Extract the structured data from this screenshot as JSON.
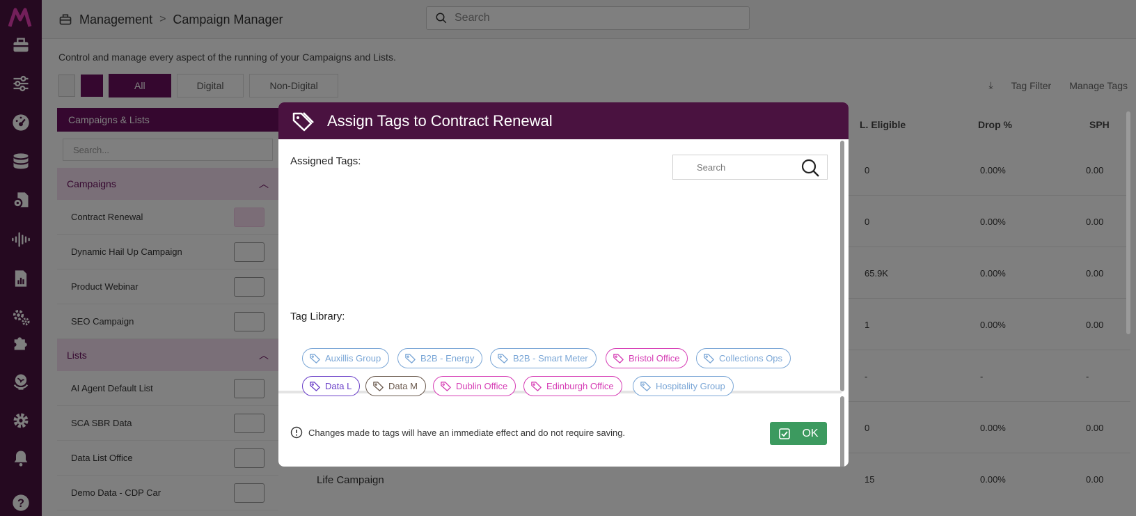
{
  "app": {
    "logo_text": "M"
  },
  "breadcrumb": {
    "section": "Management",
    "separator": ">",
    "page": "Campaign Manager"
  },
  "top_search": {
    "placeholder": "Search"
  },
  "page": {
    "description": "Control and manage every aspect of the running of your Campaigns and Lists.",
    "filters": [
      "All",
      "Digital",
      "Non-Digital"
    ],
    "tools": [
      "Tag Filter",
      "Manage Tags"
    ],
    "list_header": "Campaigns & Lists",
    "list_search_placeholder": "Search...",
    "groups": {
      "campaigns": "Campaigns",
      "lists": "Lists"
    },
    "campaign_rows": [
      "Contract Renewal",
      "Dynamic Hail Up Campaign",
      "Product Webinar",
      "SEO Campaign"
    ],
    "list_rows": [
      "AI Agent Default List",
      "SCA SBR Data",
      "Data List Office",
      "Demo Data - CDP Car"
    ],
    "table_headers": [
      "L. Eligible",
      "Drop %",
      "SPH"
    ],
    "table_rows": [
      [
        "0",
        "0.00%",
        "0.00"
      ],
      [
        "0",
        "0.00%",
        "0.00"
      ],
      [
        "65.9K",
        "0.00%",
        "0.00"
      ],
      [
        "1",
        "0.00%",
        "0.00"
      ],
      [
        "-",
        "-",
        "-"
      ],
      [
        "0",
        "0.00%",
        "0.00"
      ],
      [
        "15",
        "0.00%",
        "0.00"
      ]
    ],
    "extra_row_label": "Life Campaign"
  },
  "modal": {
    "title": "Assign Tags to Contract Renewal",
    "assigned_label": "Assigned Tags:",
    "search_placeholder": "Search",
    "library_label": "Tag Library:",
    "tags": [
      {
        "label": "Auxillis Group",
        "color": "#7aa6d6"
      },
      {
        "label": "B2B - Energy",
        "color": "#7aa6d6"
      },
      {
        "label": "B2B - Smart Meter",
        "color": "#7aa6d6"
      },
      {
        "label": "Bristol Office",
        "color": "#d63db5"
      },
      {
        "label": "Collections Ops",
        "color": "#7aa6d6"
      },
      {
        "label": "Data L",
        "color": "#6a3fc8"
      },
      {
        "label": "Data M",
        "color": "#6b5a4e"
      },
      {
        "label": "Dublin Office",
        "color": "#d63db5"
      },
      {
        "label": "Edinburgh Office",
        "color": "#d63db5"
      },
      {
        "label": "Hospitality Group",
        "color": "#7aa6d6"
      }
    ],
    "notice": "Changes made to tags will have an immediate effect and do not require saving.",
    "ok_label": "OK"
  },
  "colors": {
    "brand": "#4a1240",
    "accent": "#d63db5",
    "ok": "#3c9a5f"
  },
  "icons": [
    "toolbox-icon",
    "sliders-icon",
    "dashboard-icon",
    "database-icon",
    "files-icon",
    "audio-icon",
    "report-icon",
    "settings-pair-icon",
    "plugin-icon",
    "globe-icon",
    "gear-icon",
    "bell-icon",
    "help-icon",
    "tag-icon",
    "search-icon",
    "alert-circle-icon",
    "check-square-icon"
  ]
}
